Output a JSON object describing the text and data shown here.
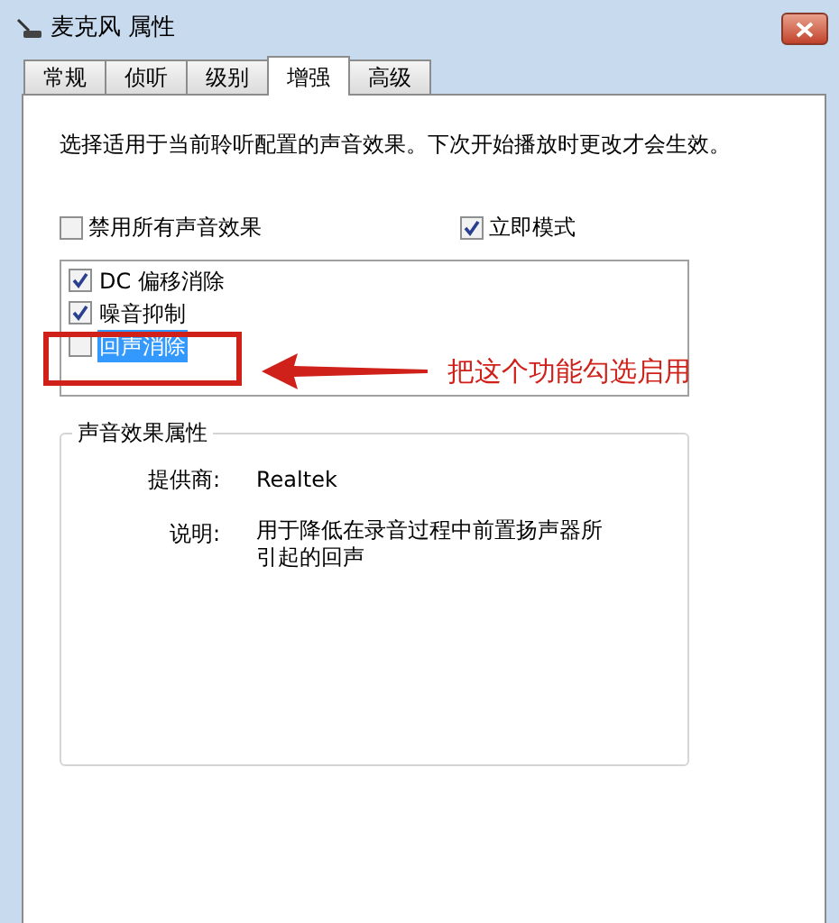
{
  "window": {
    "title": "麦克风 属性"
  },
  "tabs": [
    {
      "label": "常规",
      "selected": false
    },
    {
      "label": "侦听",
      "selected": false
    },
    {
      "label": "级别",
      "selected": false
    },
    {
      "label": "增强",
      "selected": true
    },
    {
      "label": "高级",
      "selected": false
    }
  ],
  "description": "选择适用于当前聆听配置的声音效果。下次开始播放时更改才会生效。",
  "disable_all": {
    "label": "禁用所有声音效果",
    "checked": false
  },
  "immediate_mode": {
    "label": "立即模式",
    "checked": true
  },
  "effects": [
    {
      "label": "DC 偏移消除",
      "checked": true,
      "selected": false
    },
    {
      "label": "噪音抑制",
      "checked": true,
      "selected": false
    },
    {
      "label": "回声消除",
      "checked": false,
      "selected": true
    }
  ],
  "properties": {
    "title": "声音效果属性",
    "provider_label": "提供商:",
    "provider": "Realtek",
    "description_label": "说明:",
    "description": "用于降低在录音过程中前置扬声器所引起的回声"
  },
  "annotation": {
    "text": "把这个功能勾选启用"
  }
}
